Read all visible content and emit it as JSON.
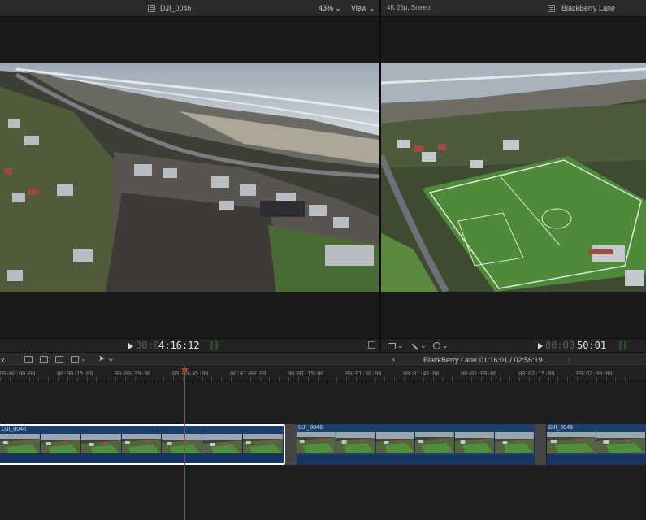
{
  "viewer_left": {
    "clip_name": "DJI_0046",
    "zoom": "43%",
    "view_menu": "View",
    "timecode_dim": "00:0",
    "timecode": "4:16:12"
  },
  "viewer_right": {
    "format": "4K 25p, Stereo",
    "project_name": "BlackBerry Lane",
    "timecode_dim": "00:00",
    "timecode": "50:01"
  },
  "timeline": {
    "project_name": "BlackBerry Lane",
    "duration": "01:16:01 / 02:56:19",
    "close_label": "x",
    "ruler_ticks": [
      "00:00:00:00",
      "00:00:15:00",
      "00:00:30:00",
      "00:00:45:00",
      "00:01:00:00",
      "00:01:15:00",
      "00:01:30:00",
      "00:01:45:00",
      "00:02:00:00",
      "00:02:15:00",
      "00:02:30:00"
    ],
    "clips": [
      {
        "name": "DJI_0046",
        "selected": true
      },
      {
        "name": "DJI_0046",
        "selected": false
      },
      {
        "name": "DJI_0046",
        "selected": false
      }
    ]
  },
  "icons": [
    "film-icon",
    "play-icon",
    "fullscreen-icon",
    "transform-icon",
    "enhance-wand-icon",
    "speed-gauge-icon",
    "clip-appearance-icon",
    "arrow-tool-icon",
    "back-arrow-icon",
    "forward-arrow-icon"
  ],
  "colors": {
    "playhead": "#c0392b",
    "clip_blue": "#1d3f6e",
    "selection": "#ffffff"
  }
}
